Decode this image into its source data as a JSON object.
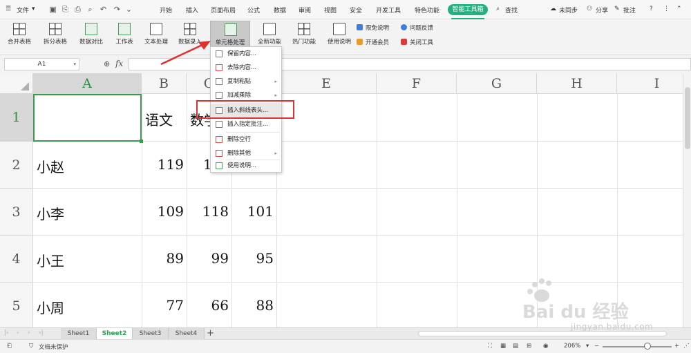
{
  "menubar": {
    "file": "文件",
    "tabs": [
      "开始",
      "插入",
      "页面布局",
      "公式",
      "数据",
      "审阅",
      "视图",
      "安全",
      "开发工具",
      "特色功能"
    ],
    "smart_tab": "智能工具箱",
    "search": "查找",
    "sync": "未同步",
    "share": "分享",
    "comment": "批注"
  },
  "ribbon": {
    "buttons": [
      "合并表格",
      "拆分表格",
      "数据对比",
      "工作表",
      "文本处理",
      "数据录入",
      "单元格处理",
      "全新功能",
      "热门功能",
      "使用说明"
    ],
    "side_links": [
      "限免说明",
      "开通会员",
      "问题反馈",
      "关闭工具"
    ]
  },
  "formula_bar": {
    "cell_ref": "A1",
    "fx": "fx"
  },
  "grid": {
    "columns": [
      "A",
      "B",
      "C",
      "D",
      "E",
      "F",
      "G",
      "H",
      "I"
    ],
    "rows": [
      "1",
      "2",
      "3",
      "4",
      "5"
    ],
    "cells": {
      "B1": "语文",
      "C1": "数学",
      "A2": "小赵",
      "B2": "119",
      "C2": "1",
      "A3": "小李",
      "B3": "109",
      "C3": "118",
      "D3": "101",
      "A4": "小王",
      "B4": "89",
      "C4": "99",
      "D4": "95",
      "A5": "小周",
      "B5": "77",
      "C5": "66",
      "D5": "88"
    }
  },
  "dropdown": {
    "items": [
      "保留内容...",
      "去除内容...",
      "复制粘贴",
      "加减乘除",
      "插入斜线表头...",
      "插入指定批注...",
      "删除空行",
      "删除其他",
      "使用说明..."
    ]
  },
  "sheets": [
    "Sheet1",
    "Sheet2",
    "Sheet3",
    "Sheet4"
  ],
  "statusbar": {
    "doc_status": "文档未保护",
    "zoom": "206%"
  },
  "watermark": {
    "text": "jingyan.baidu.com"
  },
  "colors": {
    "accent": "#27b07f",
    "highlight": "#e03030"
  }
}
